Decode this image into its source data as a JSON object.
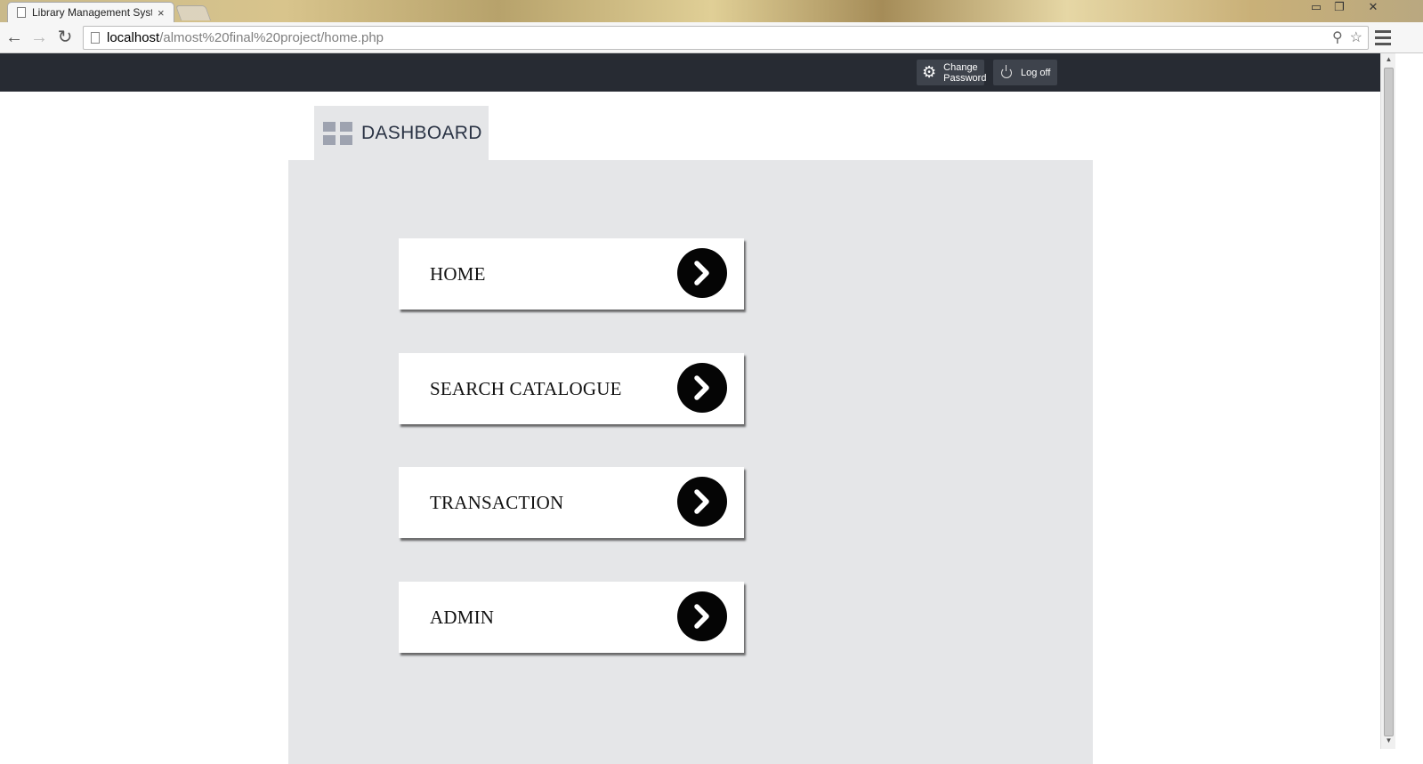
{
  "browser": {
    "tab_title": "Library Management System",
    "tab_close": "×",
    "url_host": "localhost",
    "url_path": "/almost%20final%20project/home.php",
    "window_controls": {
      "minimize": "▭",
      "restore": "❐",
      "close": "✕"
    }
  },
  "topnav": {
    "change_password_line1": "Change",
    "change_password_line2": "Password",
    "logoff_label": "Log off"
  },
  "dashboard": {
    "title": "DASHBOARD"
  },
  "menu": {
    "items": [
      {
        "label": "HOME",
        "icon": "chevron-right-icon"
      },
      {
        "label": "SEARCH CATALOGUE",
        "icon": "chevron-right-icon"
      },
      {
        "label": "TRANSACTION",
        "icon": "chevron-right-icon"
      },
      {
        "label": "ADMIN",
        "icon": "chevron-right-icon"
      }
    ]
  },
  "colors": {
    "topnav_bg": "#272b33",
    "panel_bg": "#e5e6e8",
    "arrow_bg": "#050505"
  }
}
